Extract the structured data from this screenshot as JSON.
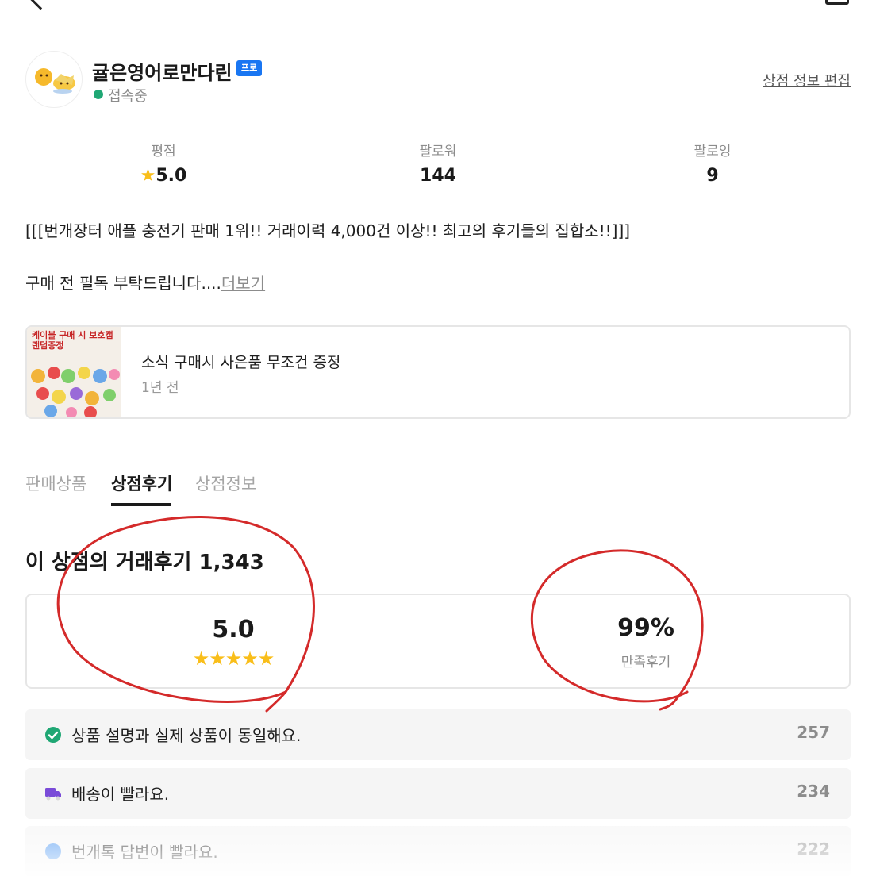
{
  "header": {
    "back_icon": "back-arrow-icon",
    "share_icon": "square-icon"
  },
  "profile": {
    "name": "귤은영어로만다린",
    "badge": "프로",
    "status": "접속중",
    "edit_label": "상점 정보 편집",
    "status_color": "#1fa774",
    "badge_color": "#1976f2"
  },
  "stats": [
    {
      "label": "평점",
      "value": "5.0"
    },
    {
      "label": "팔로워",
      "value": "144"
    },
    {
      "label": "팔로잉",
      "value": "9"
    }
  ],
  "intro": {
    "line1": "[[[번개장터 애플 충전기 판매 1위!! 거래이력 4,000건 이상!! 최고의 후기들의 집합소!!]]]",
    "line2": "구매 전 필독 부탁드립니다....",
    "more": "더보기"
  },
  "news": {
    "thumb_caption": "케이블 구매 시 보호캡 랜덤증정",
    "title": "소식 구매시 사은품 무조건 증정",
    "time": "1년 전"
  },
  "tabs": [
    {
      "label": "판매상품",
      "active": false
    },
    {
      "label": "상점후기",
      "active": true
    },
    {
      "label": "상점정보",
      "active": false
    }
  ],
  "reviews": {
    "title": "이 상점의 거래후기 1,343",
    "rating": "5.0",
    "rating_stars": 5,
    "satisfaction": "99%",
    "satisfaction_label": "만족후기",
    "rows": [
      {
        "icon": "check-circle-icon",
        "text": "상품 설명과 실제 상품이 동일해요.",
        "count": "257"
      },
      {
        "icon": "delivery-truck-icon",
        "text": "배송이 빨라요.",
        "count": "234"
      },
      {
        "icon": "chat-bubble-icon",
        "text": "번개톡 답변이 빨라요.",
        "count": "222"
      }
    ]
  },
  "colors": {
    "star": "#f9be1a",
    "annotation": "#d42a2a",
    "check": "#1fa774",
    "truck": "#7a4bd8"
  }
}
